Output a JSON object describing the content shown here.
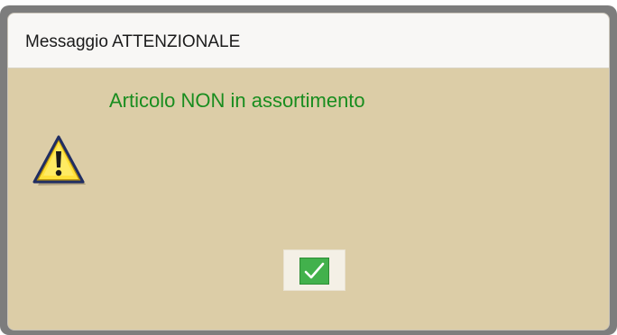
{
  "dialog": {
    "title": "Messaggio ATTENZIONALE",
    "message": "Articolo NON in assortimento",
    "message_color": "#198d1f",
    "body_color": "#dccda7",
    "icon": "warning-icon",
    "ok_icon": "check-icon"
  }
}
